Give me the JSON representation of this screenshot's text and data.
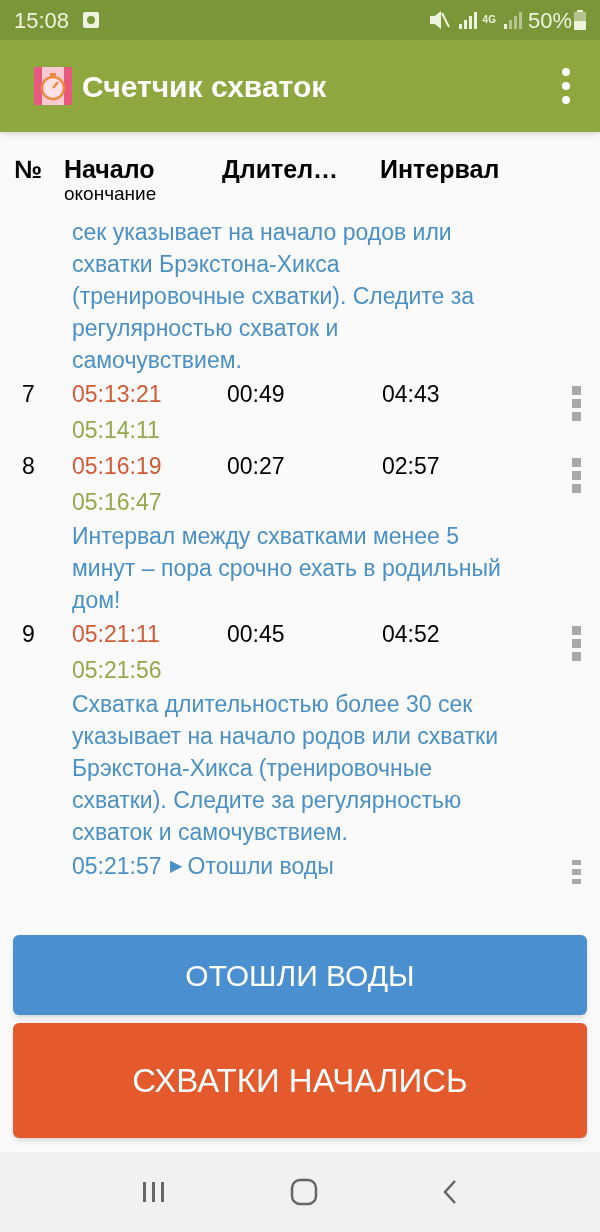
{
  "status_bar": {
    "time": "15:08",
    "battery": "50%",
    "network": "4G"
  },
  "app_bar": {
    "title": "Счетчик схваток"
  },
  "table": {
    "columns": [
      {
        "label": "№"
      },
      {
        "label": "Начало",
        "sublabel": "окончание"
      },
      {
        "label": "Длител…"
      },
      {
        "label": "Интервал"
      }
    ],
    "rows": [
      {
        "kind": "note",
        "text": "сек указывает на начало родов или схватки Брэкстона-Хикса (тренировочные схватки). Следите за регулярностью схваток и самочувствием."
      },
      {
        "kind": "contraction",
        "number": "7",
        "start": "05:13:21",
        "end": "05:14:11",
        "duration": "00:49",
        "interval": "04:43"
      },
      {
        "kind": "contraction",
        "number": "8",
        "start": "05:16:19",
        "end": "05:16:47",
        "duration": "00:27",
        "interval": "02:57"
      },
      {
        "kind": "note",
        "text": "Интервал между схватками менее 5 минут – пора срочно ехать в родильный дом!"
      },
      {
        "kind": "contraction",
        "number": "9",
        "start": "05:21:11",
        "end": "05:21:56",
        "duration": "00:45",
        "interval": "04:52"
      },
      {
        "kind": "note",
        "text": "Схватка длительностью более 30 сек указывает на начало родов или схватки Брэкстона-Хикса (тренировочные схватки). Следите за регулярностью схваток и самочувствием."
      },
      {
        "kind": "event",
        "time": "05:21:57",
        "marker": "▶",
        "label": "Отошли воды"
      }
    ]
  },
  "buttons": [
    {
      "label": "ОТОШЛИ ВОДЫ",
      "color": "#4a8fd0"
    },
    {
      "label": "СХВАТКИ НАЧАЛИСЬ",
      "color": "#e45a2c"
    }
  ]
}
